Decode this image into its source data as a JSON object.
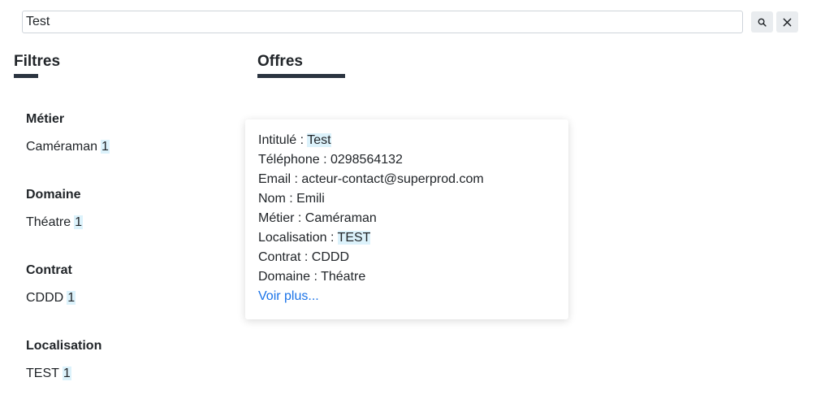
{
  "search": {
    "value": "Test",
    "search_icon": "search-icon",
    "clear_icon": "close-icon"
  },
  "filters": {
    "title": "Filtres",
    "groups": [
      {
        "title": "Métier",
        "value": "Caméraman",
        "count": "1"
      },
      {
        "title": "Domaine",
        "value": "Théatre",
        "count": "1"
      },
      {
        "title": "Contrat",
        "value": "CDDD",
        "count": "1"
      },
      {
        "title": "Localisation",
        "value": "TEST",
        "count": "1"
      }
    ]
  },
  "offers": {
    "title": "Offres",
    "items": [
      {
        "intitule_label": "Intitulé : ",
        "intitule_value": "Test",
        "telephone": "Téléphone : 0298564132",
        "email": "Email : acteur-contact@superprod.com",
        "nom": "Nom : Emili",
        "metier": "Métier : Caméraman",
        "localisation_label": "Localisation : ",
        "localisation_value": "TEST",
        "contrat": "Contrat : CDDD",
        "domaine": "Domaine : Théatre",
        "more_link": "Voir plus..."
      }
    ]
  },
  "colors": {
    "accent_underline": "#2b3440",
    "highlight": "#dcf2fb",
    "link": "#1a73e8"
  }
}
